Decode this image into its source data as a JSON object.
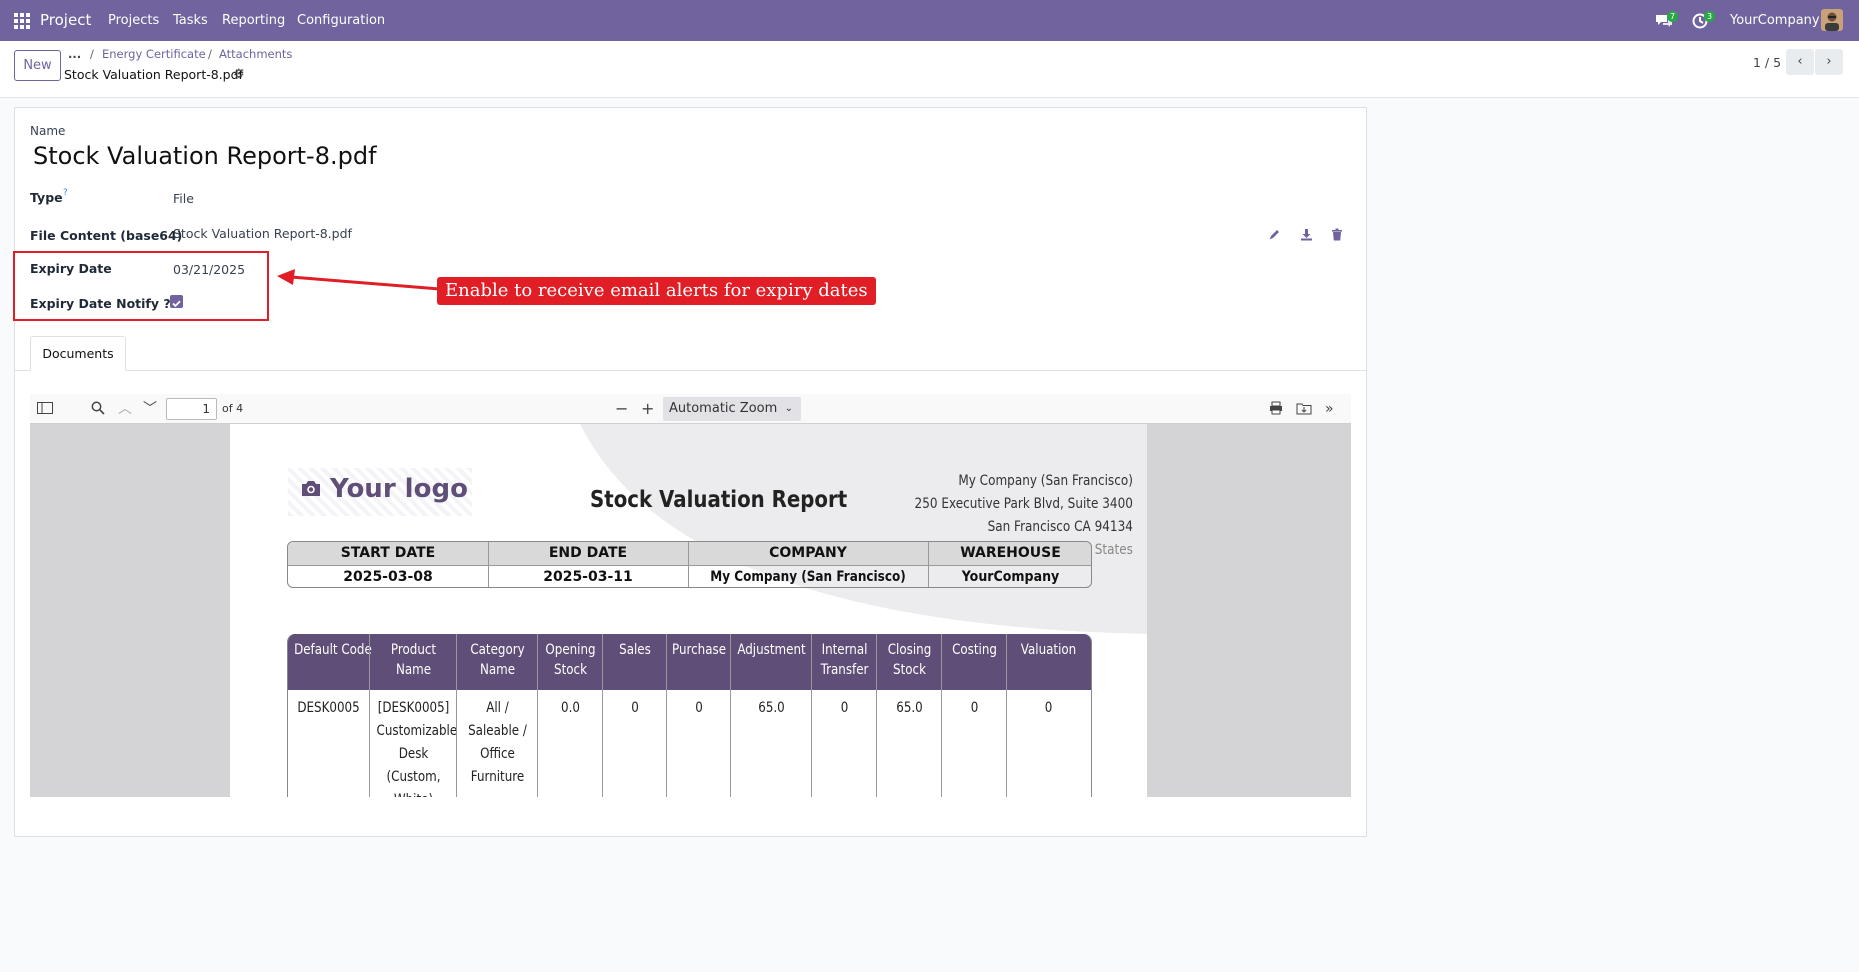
{
  "navbar": {
    "app_name": "Project",
    "menu": [
      "Projects",
      "Tasks",
      "Reporting",
      "Configuration"
    ],
    "messages_count": "7",
    "activities_count": "3",
    "company": "YourCompany"
  },
  "control_panel": {
    "new_label": "New",
    "breadcrumb_more": "...",
    "breadcrumbs": [
      "Energy Certificate",
      "Attachments"
    ],
    "current_record": "Stock Valuation Report-8.pdf",
    "pager": "1 / 5"
  },
  "form": {
    "name_label": "Name",
    "name_value": "Stock Valuation Report-8.pdf",
    "type_label": "Type",
    "type_help": "?",
    "type_value": "File",
    "file_content_label": "File Content (base64)",
    "file_content_value": "Stock Valuation Report-8.pdf",
    "expiry_date_label": "Expiry Date",
    "expiry_date_value": "03/21/2025",
    "expiry_notify_label": "Expiry Date Notify ??",
    "expiry_notify_checked": true
  },
  "annotation": {
    "text": "Enable to receive email alerts for expiry dates",
    "color": "#e11d26"
  },
  "tabs": [
    "Documents"
  ],
  "pdf_viewer": {
    "page_number": "1",
    "page_count": "of 4",
    "zoom": "Automatic Zoom"
  },
  "report": {
    "logo_text": "Your logo",
    "title": "Stock Valuation Report",
    "company_address": [
      "My Company (San Francisco)",
      "250 Executive Park Blvd, Suite 3400",
      "San Francisco CA 94134",
      "United States"
    ],
    "info_headers": [
      "START DATE",
      "END DATE",
      "COMPANY",
      "WAREHOUSE"
    ],
    "info_values": [
      "2025-03-08",
      "2025-03-11",
      "My Company (San Francisco)",
      "YourCompany"
    ],
    "table_headers": [
      [
        "Default Code"
      ],
      [
        "Product",
        "Name"
      ],
      [
        "Category",
        "Name"
      ],
      [
        "Opening",
        "Stock"
      ],
      [
        "Sales"
      ],
      [
        "Purchase"
      ],
      [
        "Adjustment"
      ],
      [
        "Internal",
        "Transfer"
      ],
      [
        "Closing",
        "Stock"
      ],
      [
        "Costing"
      ],
      [
        "Valuation"
      ]
    ],
    "rows": [
      [
        [
          "DESK0005"
        ],
        [
          "[DESK0005]",
          "Customizable",
          "Desk",
          "(Custom,",
          "White)"
        ],
        [
          "All /",
          "Saleable /",
          "Office",
          "Furniture"
        ],
        [
          "0.0"
        ],
        [
          "0"
        ],
        [
          "0"
        ],
        [
          "65.0"
        ],
        [
          "0"
        ],
        [
          "65.0"
        ],
        [
          "0"
        ],
        [
          "0"
        ]
      ]
    ]
  },
  "colors": {
    "brand": "#71639e",
    "report_header": "#5f4e77"
  }
}
